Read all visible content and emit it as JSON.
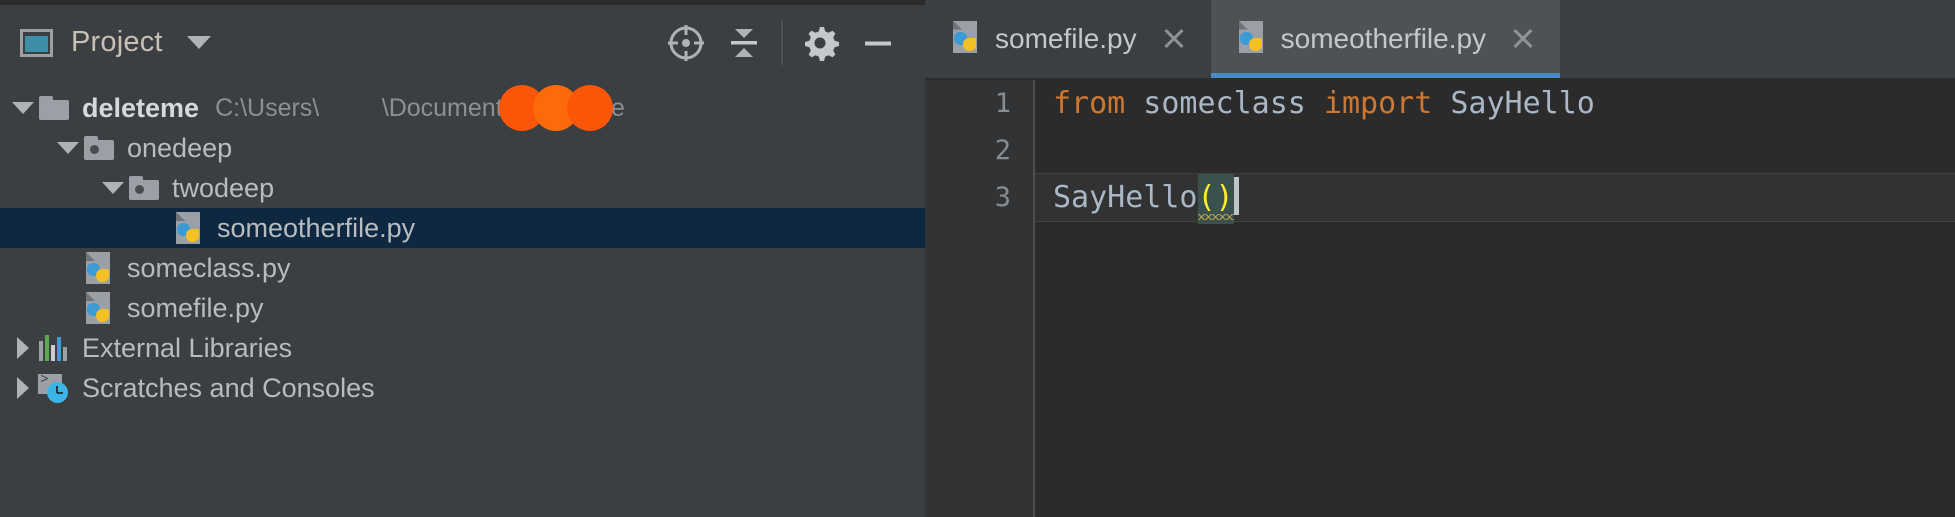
{
  "theme": {
    "panel_bg": "#3c3f41",
    "editor_bg": "#2b2b2b",
    "gutter_bg": "#313335",
    "selection_bg": "#0d2840",
    "active_tab_bg": "#4e5254",
    "tab_underline": "#4a88c7",
    "keyword_color": "#cc7832",
    "identifier_color": "#a9b7c6",
    "bracket_match_color": "#ffef28",
    "redaction_color": "#fb5607"
  },
  "project_panel": {
    "title": "Project",
    "window_icon": "project-window-icon",
    "dropdown_icon": "chevron-down-icon",
    "toolbar": [
      {
        "name": "select-opened-file-button",
        "icon": "crosshair-target-icon"
      },
      {
        "name": "collapse-all-button",
        "icon": "collapse-all-icon"
      },
      {
        "name": "settings-button",
        "icon": "gear-icon"
      },
      {
        "name": "hide-button",
        "icon": "minus-icon"
      }
    ],
    "tree": [
      {
        "label": "deleteme",
        "path": "C:\\Users\\",
        "path_suffix": "\\Documents\\deleteme",
        "redacted": true,
        "icon": "folder-icon",
        "arrow": "expanded",
        "indent": 0,
        "bold": true,
        "selected": false
      },
      {
        "label": "onedeep",
        "icon": "package-folder-icon",
        "arrow": "expanded",
        "indent": 1,
        "bold": false,
        "selected": false
      },
      {
        "label": "twodeep",
        "icon": "package-folder-icon",
        "arrow": "expanded",
        "indent": 2,
        "bold": false,
        "selected": false
      },
      {
        "label": "someotherfile.py",
        "icon": "python-file-icon",
        "arrow": "none",
        "indent": 3,
        "bold": false,
        "selected": true
      },
      {
        "label": "someclass.py",
        "icon": "python-file-icon",
        "arrow": "none",
        "indent": 1,
        "bold": false,
        "selected": false
      },
      {
        "label": "somefile.py",
        "icon": "python-file-icon",
        "arrow": "none",
        "indent": 1,
        "bold": false,
        "selected": false
      },
      {
        "label": "External Libraries",
        "icon": "external-libraries-icon",
        "arrow": "collapsed",
        "indent": 0,
        "bold": false,
        "selected": false
      },
      {
        "label": "Scratches and Consoles",
        "icon": "scratches-consoles-icon",
        "arrow": "collapsed",
        "indent": 0,
        "bold": false,
        "selected": false
      }
    ]
  },
  "editor": {
    "tabs": [
      {
        "label": "somefile.py",
        "icon": "python-file-icon",
        "active": false,
        "close_icon": "close-icon"
      },
      {
        "label": "someotherfile.py",
        "icon": "python-file-icon",
        "active": true,
        "close_icon": "close-icon"
      }
    ],
    "line_numbers": [
      "1",
      "2",
      "3"
    ],
    "lines": [
      {
        "number": "1",
        "current": false,
        "tokens": [
          {
            "text": "from",
            "type": "keyword"
          },
          {
            "text": " someclass ",
            "type": "identifier"
          },
          {
            "text": "import",
            "type": "keyword"
          },
          {
            "text": " SayHello",
            "type": "identifier"
          }
        ]
      },
      {
        "number": "2",
        "current": false,
        "tokens": []
      },
      {
        "number": "3",
        "current": true,
        "tokens": [
          {
            "text": "SayHello",
            "type": "identifier"
          },
          {
            "text": "()",
            "type": "bracket-match"
          }
        ]
      }
    ],
    "caret": {
      "line": 3,
      "after_text": "SayHello()"
    }
  }
}
